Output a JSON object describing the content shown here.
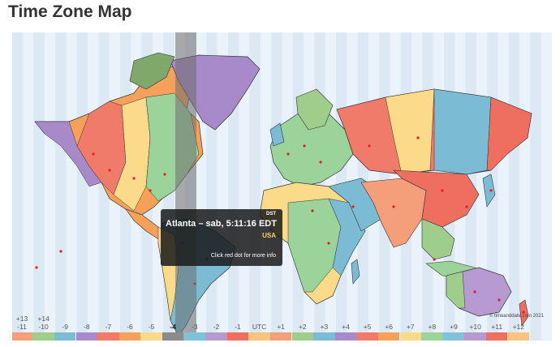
{
  "page": {
    "title": "Time Zone Map"
  },
  "tooltip": {
    "dst_badge": "DST",
    "city_line": "Atlanta – sab, 5:11:16 EDT",
    "country": "USA",
    "hint": "Click red dot for more info"
  },
  "copyright": "© timeanddate.com 2021",
  "scale": {
    "extra_labels": [
      "+13",
      "+14"
    ],
    "labels": [
      "-11",
      "-10",
      "-9",
      "-8",
      "-7",
      "-6",
      "-5",
      "-4",
      "-3",
      "-2",
      "-1",
      "UTC",
      "+1",
      "+2",
      "+3",
      "+4",
      "+5",
      "+6",
      "+7",
      "+8",
      "+9",
      "+10",
      "+11",
      "+12"
    ],
    "selected": "-4"
  },
  "colors": {
    "ocean": "#eaf3fb",
    "zone_palette": [
      "#f59f7a",
      "#9fcd8b",
      "#7bbcd4",
      "#a889c9",
      "#f07b6a",
      "#f7a05a",
      "#fbdb8a",
      "#9bd39b",
      "#7fc3d8",
      "#b89ad3",
      "#ee6f5f",
      "#fcc57e"
    ],
    "city_dot": "#e02020",
    "highlight_band": "#8c8c8c",
    "tooltip_bg": "#191919",
    "country_text": "#f7d35a"
  }
}
